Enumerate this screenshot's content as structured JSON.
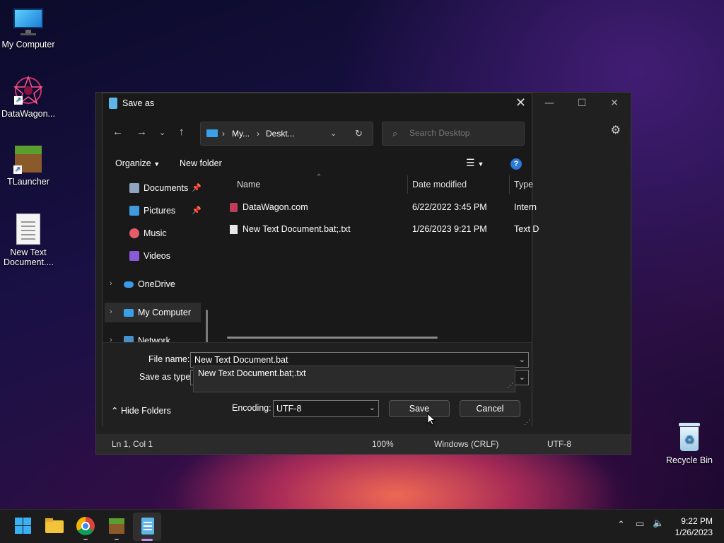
{
  "desktop": {
    "icons": [
      {
        "label": "My Computer"
      },
      {
        "label": "DataWagon..."
      },
      {
        "label": "TLauncher"
      },
      {
        "label": "New Text Document...."
      },
      {
        "label": "Recycle Bin"
      }
    ]
  },
  "notepad": {
    "status": {
      "position": "Ln 1, Col 1",
      "zoom": "100%",
      "line_endings": "Windows (CRLF)",
      "encoding": "UTF-8"
    }
  },
  "dialog": {
    "title": "Save as",
    "breadcrumb": [
      "My...",
      "Deskt..."
    ],
    "search_placeholder": "Search Desktop",
    "toolbar": {
      "organize": "Organize",
      "new_folder": "New folder"
    },
    "nav_items": [
      {
        "label": "Documents"
      },
      {
        "label": "Pictures"
      },
      {
        "label": "Music"
      },
      {
        "label": "Videos"
      },
      {
        "label": "OneDrive"
      },
      {
        "label": "My Computer"
      },
      {
        "label": "Network"
      }
    ],
    "columns": {
      "name": "Name",
      "date": "Date modified",
      "type": "Type"
    },
    "files": [
      {
        "name": "DataWagon.com",
        "date": "6/22/2022 3:45 PM",
        "type": "Intern"
      },
      {
        "name": "New Text Document.bat;.txt",
        "date": "1/26/2023 9:21 PM",
        "type": "Text D"
      }
    ],
    "file_name_label": "File name:",
    "file_name_value": "New Text Document.bat",
    "suggestion": "New Text Document.bat;.txt",
    "save_as_type_label": "Save as type:",
    "hide_folders": "Hide Folders",
    "encoding_label": "Encoding:",
    "encoding_value": "UTF-8",
    "save": "Save",
    "cancel": "Cancel"
  },
  "taskbar": {
    "time": "9:22 PM",
    "date": "1/26/2023"
  }
}
